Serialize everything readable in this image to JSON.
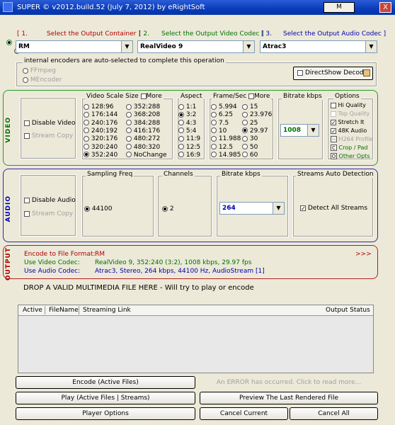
{
  "window": {
    "title": "SUPER © v2012.build.52 (July 7, 2012) by eRightSoft",
    "m_button": "M",
    "close": "X"
  },
  "steps": {
    "s1_num": "[ 1.",
    "s1_label": "Select the Output Container ]",
    "s2_num": "[ 2.",
    "s2_label": "Select the Output Video Codec ]",
    "s3_num": "[ 3.",
    "s3_label": "Select the Output Audio Codec ]"
  },
  "combos": {
    "container": "RM",
    "video_codec": "RealVideo 9",
    "audio_codec": "Atrac3",
    "arrow": "▼"
  },
  "encoders": {
    "legend": "internal encoders are auto-selected to complete this operation",
    "ffmpeg": "FFmpeg",
    "mencoder": "MEncoder",
    "directshow": "DirectShow Decode"
  },
  "video": {
    "side": "VIDEO",
    "disable": "Disable Video",
    "stream_copy": "Stream Copy",
    "scale_legend": "Video Scale Size",
    "scale_more": "More",
    "scale_col1": [
      "128:96",
      "176:144",
      "240:176",
      "240:192",
      "320:176",
      "320:240",
      "352:240"
    ],
    "scale_col2": [
      "352:288",
      "368:208",
      "384:288",
      "416:176",
      "480:272",
      "480:320",
      "NoChange"
    ],
    "aspect_legend": "Aspect",
    "aspect": [
      "1:1",
      "3:2",
      "4:3",
      "5:4",
      "11:9",
      "12:5",
      "16:9"
    ],
    "fps_legend": "Frame/Sec",
    "fps_more": "More",
    "fps_col1": [
      "5.994",
      "6.25",
      "7.5",
      "10",
      "11.988",
      "12.5",
      "14.985"
    ],
    "fps_col2": [
      "15",
      "23.976",
      "25",
      "29.97",
      "30",
      "50",
      "60"
    ],
    "bitrate_legend": "Bitrate  kbps",
    "bitrate": "1008",
    "options_legend": "Options",
    "options": {
      "hi_quality": "Hi Quality",
      "top_quality": "Top Quality",
      "stretch": "Stretch It",
      "k48": "48K Audio",
      "h264": "H264 Profile",
      "crop": "Crop / Pad",
      "other": "Other Opts",
      "h": "H",
      "c": "C",
      "o": "O"
    }
  },
  "audio": {
    "side": "AUDIO",
    "disable": "Disable Audio",
    "stream_copy": "Stream Copy",
    "freq_legend": "Sampling Freq",
    "freq": "44100",
    "channels_legend": "Channels",
    "channels": "2",
    "bitrate_legend": "Bitrate  kbps",
    "bitrate": "264",
    "streams_legend": "Streams Auto Detection",
    "detect_all": "Detect All Streams"
  },
  "output": {
    "side": "OUTPUT",
    "format_label": "Encode to File Format:",
    "format_value": "RM",
    "more": ">>>",
    "video_label": "Use Video Codec:",
    "video_value": "RealVideo 9,  352:240 (3:2),  1008 kbps,  29.97 fps",
    "audio_label": "Use Audio Codec:",
    "audio_value": "Atrac3,  Stereo,  264 kbps,  44100 Hz,  AudioStream [1]"
  },
  "drop_text": "DROP A VALID MULTIMEDIA FILE HERE - Will try to play or encode",
  "table": {
    "headers": [
      "Active",
      "FileName",
      "Streaming Link",
      "Output Status"
    ]
  },
  "buttons": {
    "encode": "Encode (Active Files)",
    "error": "An ERROR has occurred. Click to read more...",
    "play": "Play (Active Files | Streams)",
    "preview": "Preview The Last Rendered File",
    "player_options": "Player Options",
    "cancel_current": "Cancel Current",
    "cancel_all": "Cancel All"
  },
  "colors": {
    "step1": "#b00000",
    "step2": "#007000",
    "step3": "#0000b0",
    "video_frame": "#2a9a2a",
    "audio_frame": "#2a2ab0",
    "output_frame": "#b02020",
    "title_bar": "#0a3bb8"
  }
}
